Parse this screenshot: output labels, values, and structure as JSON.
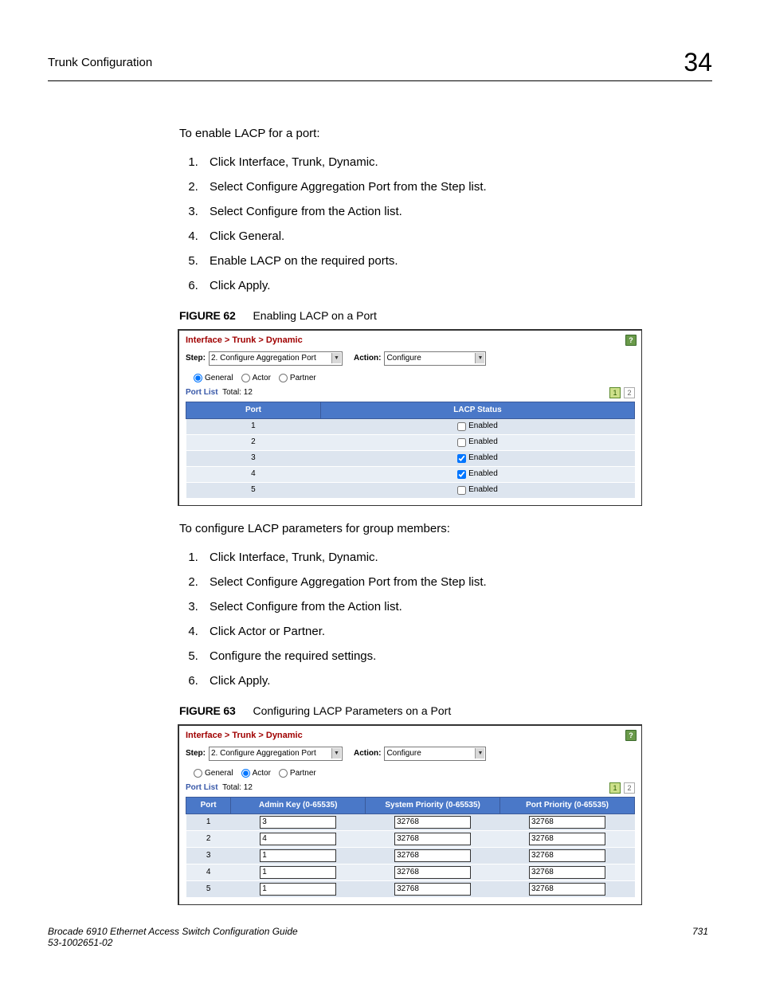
{
  "header": {
    "section": "Trunk Configuration",
    "chapter": "34"
  },
  "intro1": "To enable LACP for a port:",
  "steps1": [
    "Click Interface, Trunk, Dynamic.",
    "Select Configure Aggregation Port from the Step list.",
    "Select Configure from the Action list.",
    "Click General.",
    "Enable LACP on the required ports.",
    "Click Apply."
  ],
  "fig62": {
    "label": "FIGURE 62",
    "caption": "Enabling LACP on a Port"
  },
  "shot1": {
    "breadcrumb": "Interface > Trunk > Dynamic",
    "step_label": "Step:",
    "step_value": "2. Configure Aggregation Port",
    "action_label": "Action:",
    "action_value": "Configure",
    "radios": {
      "general": "General",
      "actor": "Actor",
      "partner": "Partner",
      "selected": "general"
    },
    "portlist_label": "Port List",
    "portlist_total": "Total: 12",
    "pager": [
      "1",
      "2"
    ],
    "cols": [
      "Port",
      "LACP Status"
    ],
    "lacp_label": "Enabled",
    "rows": [
      {
        "port": "1",
        "checked": false
      },
      {
        "port": "2",
        "checked": false
      },
      {
        "port": "3",
        "checked": true
      },
      {
        "port": "4",
        "checked": true
      },
      {
        "port": "5",
        "checked": false
      }
    ]
  },
  "intro2": "To configure LACP parameters for group members:",
  "steps2": [
    "Click Interface, Trunk, Dynamic.",
    "Select Configure Aggregation Port from the Step list.",
    "Select Configure from the Action list.",
    "Click Actor or Partner.",
    "Configure the required settings.",
    "Click Apply."
  ],
  "fig63": {
    "label": "FIGURE 63",
    "caption": "Configuring LACP Parameters on a Port"
  },
  "shot2": {
    "breadcrumb": "Interface > Trunk > Dynamic",
    "step_label": "Step:",
    "step_value": "2. Configure Aggregation Port",
    "action_label": "Action:",
    "action_value": "Configure",
    "radios": {
      "general": "General",
      "actor": "Actor",
      "partner": "Partner",
      "selected": "actor"
    },
    "portlist_label": "Port List",
    "portlist_total": "Total: 12",
    "pager": [
      "1",
      "2"
    ],
    "cols": [
      "Port",
      "Admin Key (0-65535)",
      "System Priority (0-65535)",
      "Port Priority (0-65535)"
    ],
    "rows": [
      {
        "port": "1",
        "admin": "3",
        "sys": "32768",
        "pp": "32768"
      },
      {
        "port": "2",
        "admin": "4",
        "sys": "32768",
        "pp": "32768"
      },
      {
        "port": "3",
        "admin": "1",
        "sys": "32768",
        "pp": "32768"
      },
      {
        "port": "4",
        "admin": "1",
        "sys": "32768",
        "pp": "32768"
      },
      {
        "port": "5",
        "admin": "1",
        "sys": "32768",
        "pp": "32768"
      }
    ]
  },
  "footer": {
    "doc": "Brocade 6910 Ethernet Access Switch Configuration Guide",
    "partno": "53-1002651-02",
    "page": "731"
  }
}
